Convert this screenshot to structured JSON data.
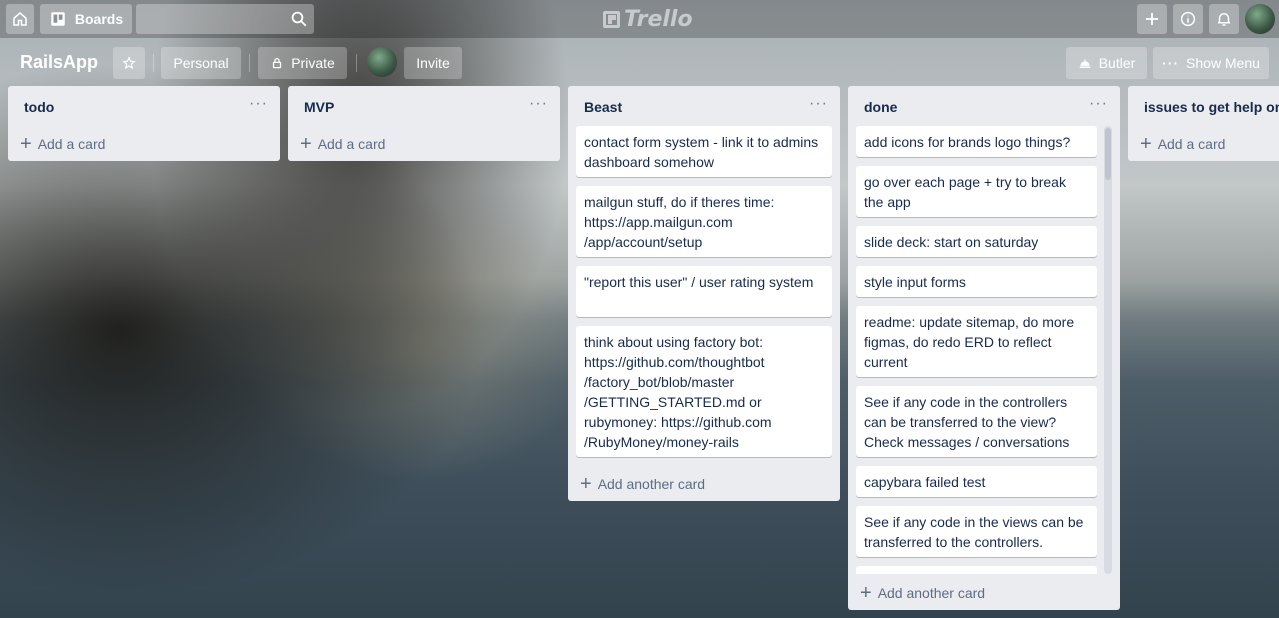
{
  "header": {
    "boards_label": "Boards",
    "search_value": "",
    "logo_text": "Trello"
  },
  "board": {
    "title": "RailsApp",
    "team_label": "Personal",
    "visibility_label": "Private",
    "invite_label": "Invite",
    "butler_label": "Butler",
    "show_menu_label": "Show Menu"
  },
  "lists": [
    {
      "title": "todo",
      "menu": "···",
      "add_label": "Add a card",
      "cards": []
    },
    {
      "title": "MVP",
      "menu": "···",
      "add_label": "Add a card",
      "cards": []
    },
    {
      "title": "Beast",
      "menu": "···",
      "add_label": "Add another card",
      "cards": [
        "contact form system - link it to admins dashboard somehow",
        "mailgun stuff, do if theres time: https://app.mailgun.com\n/app/account/setup",
        "\"report this user\" / user rating system",
        "think about using factory bot: https://github.com/thoughtbot\n/factory_bot/blob/master\n/GETTING_STARTED.md or rubymoney: https://github.com\n/RubyMoney/money-rails"
      ]
    },
    {
      "title": "done",
      "menu": "···",
      "add_label": "Add another card",
      "cards": [
        "add icons for brands logo things?",
        "go over each page + try to break the app",
        "slide deck: start on saturday",
        "style input forms",
        "readme: update sitemap, do more figmas, do redo ERD to reflect current",
        "See if any code in the controllers can be transferred to the view? Check messages / conversations",
        "capybara failed test",
        "See if any code in the views can be transferred to the controllers."
      ]
    },
    {
      "title": "issues to get help on",
      "menu": "",
      "add_label": "Add a card",
      "cards": []
    }
  ],
  "icons": {
    "home": "home-icon",
    "boards": "boards-icon",
    "search": "search-icon",
    "create": "plus-icon",
    "info": "info-icon",
    "notifications": "bell-icon",
    "star": "star-icon",
    "lock": "lock-icon",
    "butler": "butler-icon",
    "menu": "more-icon"
  },
  "colors": {
    "list_bg": "#ebecf0",
    "card_bg": "#ffffff",
    "text_primary": "#172b4d",
    "text_muted": "#5e6c84"
  }
}
